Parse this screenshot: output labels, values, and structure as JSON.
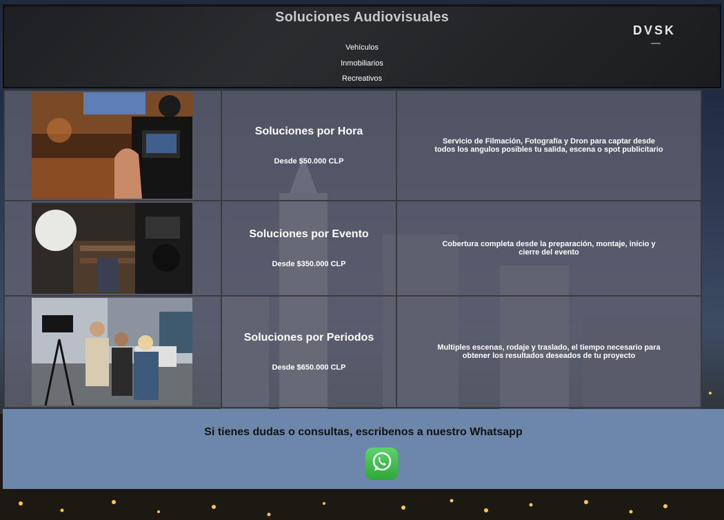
{
  "header": {
    "title": "Soluciones Audiovisuales",
    "logo": "DVSK",
    "nav": [
      {
        "label": "Vehículos"
      },
      {
        "label": "Inmobiliarios"
      },
      {
        "label": "Recreativos"
      }
    ]
  },
  "services": [
    {
      "name": "Soluciones por Hora",
      "price": "Desde $50.000 CLP",
      "description": "Servicio de Filmación, Fotografía y Dron para captar desde todos los angulos posibles tu salida, escena o spot publicitario",
      "photo": "camera-closeup-photo"
    },
    {
      "name": "Soluciones por Evento",
      "price": "Desde $350.000 CLP",
      "description": "Cobertura completa desde la preparación, montaje, inicio y cierre del evento",
      "photo": "studio-interview-photo"
    },
    {
      "name": "Soluciones por Periodos",
      "price": "Desde $650.000 CLP",
      "description": "Multiples escenas, rodaje y traslado, el tiempo necesario para obtener los resultados deseados de tu proyecto",
      "photo": "film-crew-street-photo"
    }
  ],
  "contact": {
    "text": "Si tienes dudas o consultas, escribenos a nuestro Whatsapp",
    "icon": "whatsapp-icon"
  },
  "colors": {
    "contact_bg": "#6d87aa",
    "table_cell": "#64646f",
    "whatsapp": "#2fa73a"
  }
}
